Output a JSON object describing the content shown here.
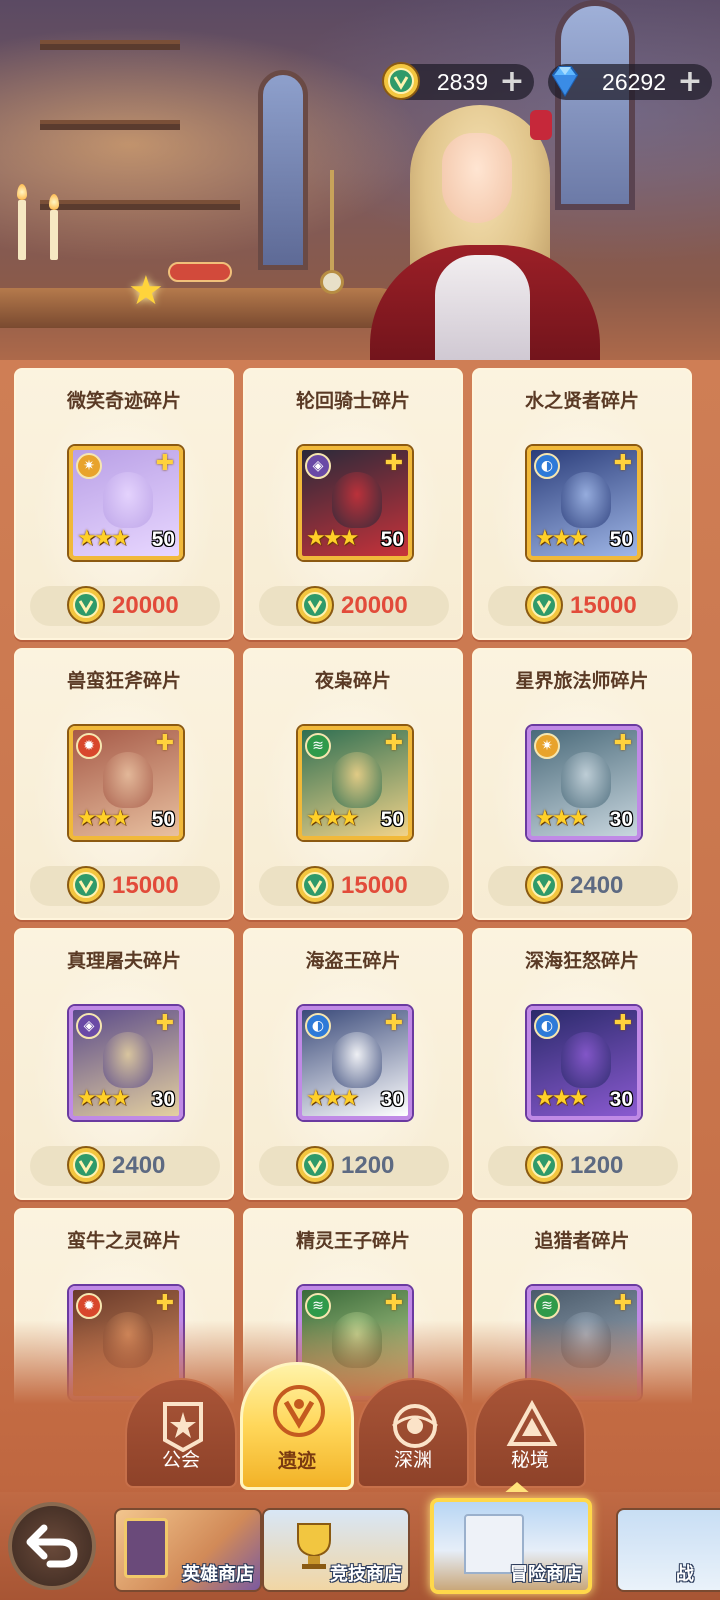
{
  "currency": [
    {
      "name": "relic-coin",
      "value": "2839",
      "icon": "relic-coin-icon"
    },
    {
      "name": "diamond",
      "value": "26292",
      "icon": "diamond-icon"
    }
  ],
  "shop_items": [
    {
      "title": "微笑奇迹碎片",
      "count": "50",
      "stars": 3,
      "price": "20000",
      "element": "light",
      "rarity": "gold",
      "price_color": "red"
    },
    {
      "title": "轮回骑士碎片",
      "count": "50",
      "stars": 3,
      "price": "20000",
      "element": "dark",
      "rarity": "gold",
      "price_color": "red"
    },
    {
      "title": "水之贤者碎片",
      "count": "50",
      "stars": 3,
      "price": "15000",
      "element": "water",
      "rarity": "gold",
      "price_color": "red"
    },
    {
      "title": "兽蛮狂斧碎片",
      "count": "50",
      "stars": 3,
      "price": "15000",
      "element": "fire",
      "rarity": "gold",
      "price_color": "red"
    },
    {
      "title": "夜枭碎片",
      "count": "50",
      "stars": 3,
      "price": "15000",
      "element": "wind",
      "rarity": "gold",
      "price_color": "red"
    },
    {
      "title": "星界旅法师碎片",
      "count": "30",
      "stars": 3,
      "price": "2400",
      "element": "light",
      "rarity": "purple",
      "price_color": "gray"
    },
    {
      "title": "真理屠夫碎片",
      "count": "30",
      "stars": 3,
      "price": "2400",
      "element": "dark",
      "rarity": "purple",
      "price_color": "gray"
    },
    {
      "title": "海盗王碎片",
      "count": "30",
      "stars": 3,
      "price": "1200",
      "element": "water",
      "rarity": "purple",
      "price_color": "gray"
    },
    {
      "title": "深海狂怒碎片",
      "count": "30",
      "stars": 3,
      "price": "1200",
      "element": "water",
      "rarity": "purple",
      "price_color": "gray"
    },
    {
      "title": "蛮牛之灵碎片",
      "count": "",
      "stars": 0,
      "price": "",
      "element": "fire",
      "rarity": "purple",
      "price_color": "gray"
    },
    {
      "title": "精灵王子碎片",
      "count": "",
      "stars": 0,
      "price": "",
      "element": "wind",
      "rarity": "purple",
      "price_color": "gray"
    },
    {
      "title": "追猎者碎片",
      "count": "",
      "stars": 0,
      "price": "",
      "element": "wind",
      "rarity": "purple",
      "price_color": "gray"
    }
  ],
  "tabs": [
    {
      "label": "公会",
      "icon": "guild-banner-icon",
      "active": false
    },
    {
      "label": "遗迹",
      "icon": "relic-emblem-icon",
      "active": true
    },
    {
      "label": "深渊",
      "icon": "abyss-emblem-icon",
      "active": false
    },
    {
      "label": "秘境",
      "icon": "secret-realm-emblem-icon",
      "active": false
    }
  ],
  "shops": [
    {
      "label": "英雄商店",
      "active": false
    },
    {
      "label": "竞技商店",
      "active": false
    },
    {
      "label": "冒险商店",
      "active": true
    },
    {
      "label": "战",
      "active": false
    }
  ],
  "colors": {
    "price_red": "#e24b3a",
    "price_gray": "#5d6a82",
    "active_tab": "#ffd75a",
    "background": "#c9714a"
  }
}
